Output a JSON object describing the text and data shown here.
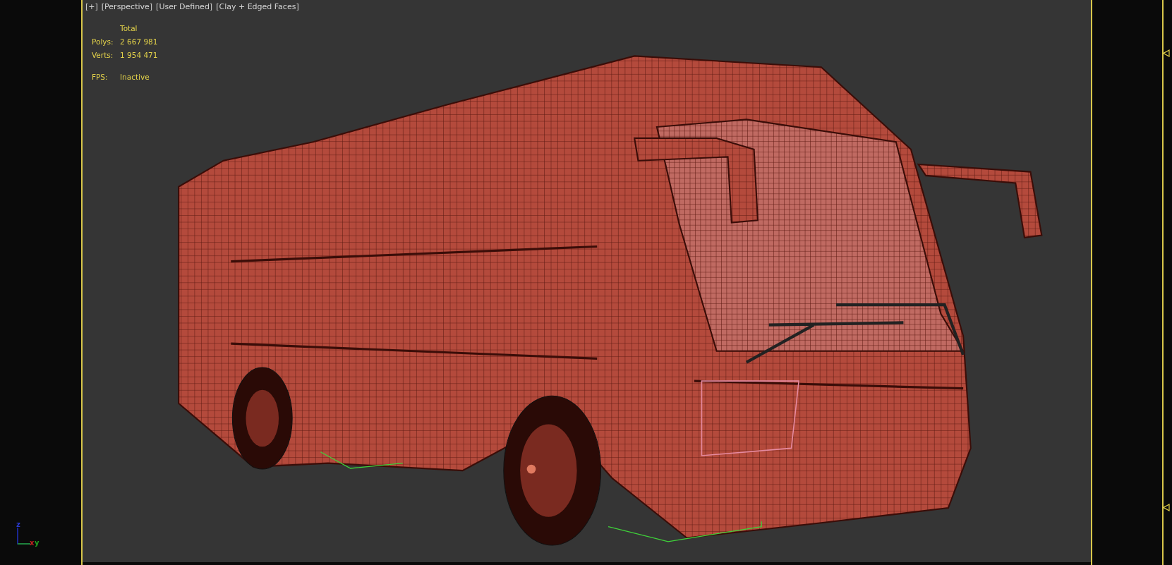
{
  "viewport": {
    "labels": [
      "[+]",
      "[Perspective]",
      "[User Defined]",
      "[Clay + Edged Faces]"
    ],
    "stats": {
      "header": "Total",
      "rows": [
        {
          "label": "Polys:",
          "value": "2 667 981"
        },
        {
          "label": "Verts:",
          "value": "1 954 471"
        }
      ],
      "fps_label": "FPS:",
      "fps_value": "Inactive"
    },
    "axes": {
      "z": "z",
      "x": "x",
      "y": "y"
    }
  }
}
